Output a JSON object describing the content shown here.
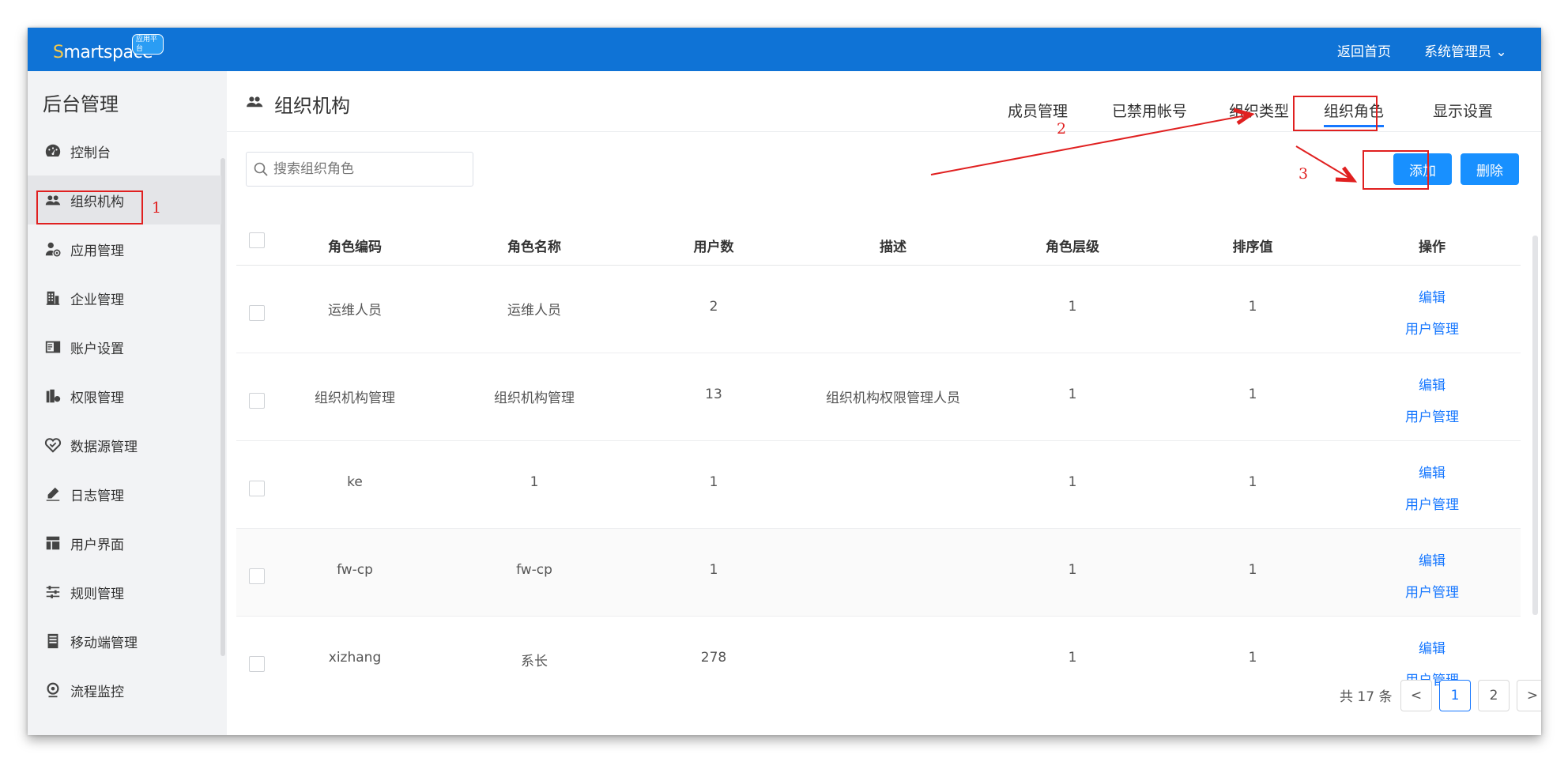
{
  "header": {
    "logo_text_s": "S",
    "logo_text_rest": "martspace",
    "logo_badge": "应用平台",
    "home_link": "返回首页",
    "user_menu": "系统管理员 ⌄"
  },
  "sidebar": {
    "title": "后台管理",
    "items": [
      {
        "label": "控制台",
        "icon": "dashboard-icon"
      },
      {
        "label": "组织机构",
        "icon": "users-icon"
      },
      {
        "label": "应用管理",
        "icon": "app-user-icon"
      },
      {
        "label": "企业管理",
        "icon": "building-icon"
      },
      {
        "label": "账户设置",
        "icon": "account-settings-icon"
      },
      {
        "label": "权限管理",
        "icon": "permission-icon"
      },
      {
        "label": "数据源管理",
        "icon": "datasource-icon"
      },
      {
        "label": "日志管理",
        "icon": "log-icon"
      },
      {
        "label": "用户界面",
        "icon": "layout-icon"
      },
      {
        "label": "规则管理",
        "icon": "rules-icon"
      },
      {
        "label": "移动端管理",
        "icon": "mobile-icon"
      },
      {
        "label": "流程监控",
        "icon": "monitor-icon"
      }
    ]
  },
  "page": {
    "title": "组织机构",
    "tabs": [
      "成员管理",
      "已禁用帐号",
      "组织类型",
      "组织角色",
      "显示设置"
    ],
    "active_tab": "组织角色",
    "search_placeholder": "搜索组织角色",
    "add_button": "添加",
    "delete_button": "删除"
  },
  "table": {
    "columns": [
      "角色编码",
      "角色名称",
      "用户数",
      "描述",
      "角色层级",
      "排序值",
      "操作"
    ],
    "rows": [
      {
        "code": "运维人员",
        "name": "运维人员",
        "users": "2",
        "desc": "",
        "level": "1",
        "sort": "1"
      },
      {
        "code": "组织机构管理",
        "name": "组织机构管理",
        "users": "13",
        "desc": "组织机构权限管理人员",
        "level": "1",
        "sort": "1"
      },
      {
        "code": "ke",
        "name": "1",
        "users": "1",
        "desc": "",
        "level": "1",
        "sort": "1"
      },
      {
        "code": "fw-cp",
        "name": "fw-cp",
        "users": "1",
        "desc": "",
        "level": "1",
        "sort": "1"
      },
      {
        "code": "xizhang",
        "name": "系长",
        "users": "278",
        "desc": "",
        "level": "1",
        "sort": "1"
      }
    ],
    "action_edit": "编辑",
    "action_users": "用户管理"
  },
  "pagination": {
    "total": "共 17 条",
    "prev": "<",
    "pages": [
      "1",
      "2"
    ],
    "current": "1",
    "next": ">"
  },
  "annotations": [
    "1",
    "2",
    "3"
  ],
  "colors": {
    "header_bg": "#0f73d6",
    "primary": "#1890ff",
    "annotation": "#e02020"
  }
}
